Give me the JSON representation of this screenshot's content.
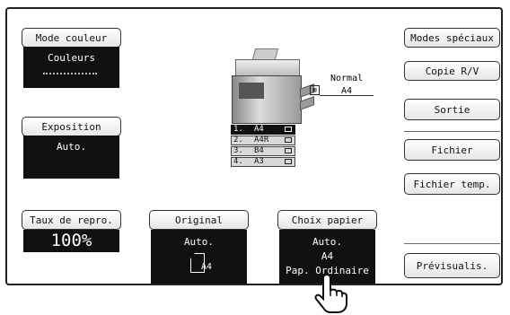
{
  "left": {
    "color_mode": {
      "label": "Mode couleur",
      "value": "Couleurs"
    },
    "exposure": {
      "label": "Exposition",
      "value": "Auto."
    },
    "ratio": {
      "label": "Taux de repro.",
      "value": "100%"
    }
  },
  "bottom": {
    "original": {
      "label": "Original",
      "value": "Auto.",
      "size": "A4"
    },
    "paper": {
      "label": "Choix papier",
      "value": "Auto.",
      "size": "A4",
      "type": "Pap. Ordinaire"
    }
  },
  "machine": {
    "output_label": "Normal",
    "output_size": "A4",
    "trays": [
      {
        "num": "1.",
        "size": "A4"
      },
      {
        "num": "2.",
        "size": "A4R"
      },
      {
        "num": "3.",
        "size": "B4"
      },
      {
        "num": "4.",
        "size": "A3"
      }
    ]
  },
  "right": {
    "special": "Modes spéciaux",
    "duplex": "Copie R/V",
    "output": "Sortie",
    "file": "Fichier",
    "quick_file": "Fichier temp.",
    "preview": "Prévisualis."
  },
  "colors": {
    "panel": "#111111",
    "border": "#333333"
  }
}
